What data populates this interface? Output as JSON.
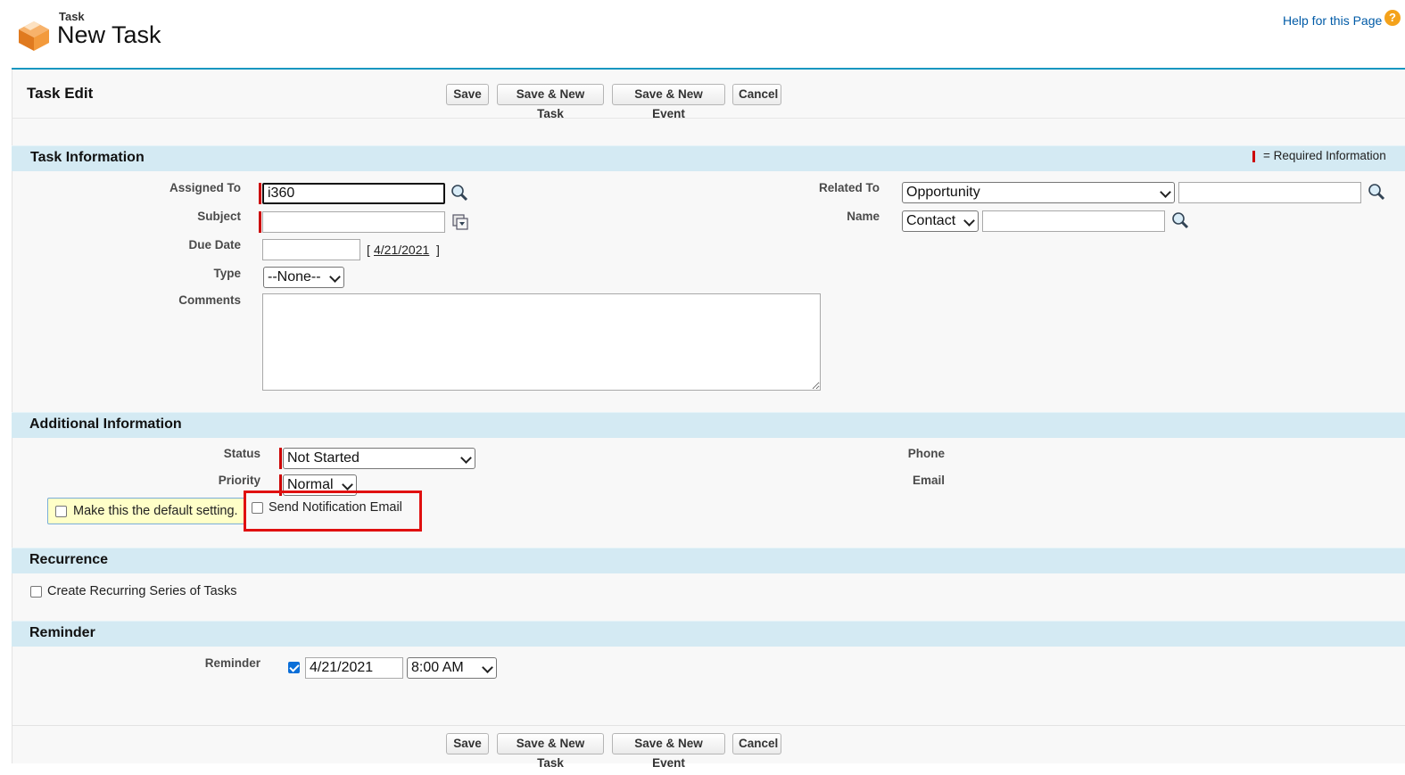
{
  "header": {
    "object_label": "Task",
    "title": "New Task",
    "help_link": "Help for this Page",
    "help_icon": "question-icon"
  },
  "page_block": {
    "title": "Task Edit",
    "buttons": [
      "Save",
      "Save & New Task",
      "Save & New Event",
      "Cancel"
    ]
  },
  "task_information": {
    "title": "Task Information",
    "required_legend": "= Required Information",
    "assigned_to": {
      "label": "Assigned To",
      "value": "i360"
    },
    "subject": {
      "label": "Subject",
      "value": ""
    },
    "due_date": {
      "label": "Due Date",
      "value": "",
      "bracket_open": "[",
      "today_link": "4/21/2021",
      "bracket_close": "]"
    },
    "type": {
      "label": "Type",
      "value": "--None--"
    },
    "comments": {
      "label": "Comments",
      "value": ""
    },
    "related_to": {
      "label": "Related To",
      "value": "Opportunity",
      "text": ""
    },
    "name": {
      "label": "Name",
      "value": "Contact",
      "text": ""
    }
  },
  "additional_information": {
    "title": "Additional Information",
    "status": {
      "label": "Status",
      "value": "Not Started"
    },
    "priority": {
      "label": "Priority",
      "value": "Normal"
    },
    "default_setting": {
      "label": "Make this the default setting.",
      "checked": false
    },
    "send_notification": {
      "label": "Send Notification Email",
      "checked": false
    },
    "phone": {
      "label": "Phone"
    },
    "email": {
      "label": "Email"
    }
  },
  "recurrence": {
    "title": "Recurrence",
    "create_series": {
      "label": "Create Recurring Series of Tasks",
      "checked": false
    }
  },
  "reminder": {
    "title": "Reminder",
    "label": "Reminder",
    "checked": true,
    "date": "4/21/2021",
    "time": "8:00 AM"
  },
  "colors": {
    "accent": "#1797c0",
    "section_bg": "#d4eaf3",
    "required": "#cc0000",
    "highlight_box": "#e01010",
    "default_box_bg": "#ffffc8"
  }
}
